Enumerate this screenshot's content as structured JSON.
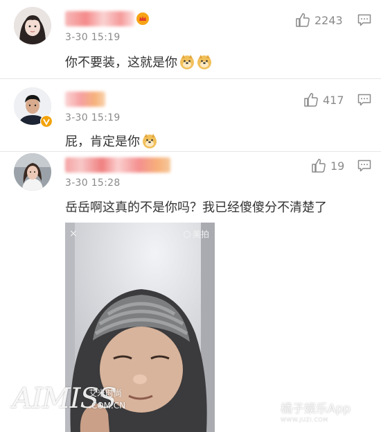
{
  "colors": {
    "text": "#333333",
    "meta": "#8a8a8a",
    "divider": "#e6e6e6",
    "vip_badge": "#f2a20b",
    "name_blur": "#f06b6b"
  },
  "comments": [
    {
      "avatar_icon": "girl-avatar",
      "badge_icon": "crown-vip-icon",
      "timestamp": "3-30 15:19",
      "text": "你不要装，这就是你",
      "emojis": [
        "doge-emoji",
        "doge-emoji"
      ],
      "like_count": "2243"
    },
    {
      "avatar_icon": "man-avatar",
      "badge_icon": "verified-v-icon",
      "timestamp": "3-30 15:19",
      "text": "屁，肯定是你",
      "emojis": [
        "doge-emoji"
      ],
      "like_count": "417"
    },
    {
      "avatar_icon": "woman-avatar",
      "badge_icon": "",
      "timestamp": "3-30 15:28",
      "text": "岳岳啊这真的不是你吗？我已经傻傻分不清楚了",
      "emojis": [],
      "like_count": "19"
    }
  ],
  "video": {
    "close_symbol": "×",
    "tag_label": "美拍"
  },
  "watermark_left": {
    "logo_text": "AIMISS",
    "brand_cn": "艾米时尚",
    "domain": ".COM.CN"
  },
  "watermark_right": {
    "app_name": "橘子娱乐App",
    "url": "WWW.JUZI.COM"
  }
}
